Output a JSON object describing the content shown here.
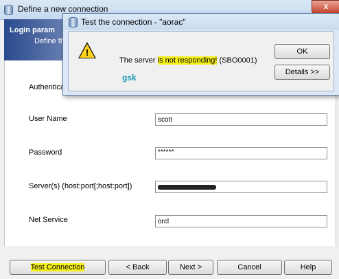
{
  "main_window": {
    "title": "Define a new connection",
    "close_glyph": "x",
    "header": {
      "title": "Login param",
      "subtitle": "Define th"
    },
    "fields": [
      {
        "label": "Authentica",
        "value": ""
      },
      {
        "label": "User Name",
        "value": "scott"
      },
      {
        "label": "Password",
        "value": "******"
      },
      {
        "label": "Server(s) (host:port[;host:port])",
        "value": ""
      },
      {
        "label": "Net Service",
        "value": "orcl"
      }
    ],
    "buttons": {
      "test_connection": "Test Connection",
      "back": "< Back",
      "next": "Next >",
      "cancel": "Cancel",
      "help": "Help"
    }
  },
  "dialog": {
    "title": "Test the connection - \"aorac\"",
    "message_before": "The server ",
    "message_highlight": "is not responding!",
    "message_after": " (SBO0001)",
    "annotation": "gsk",
    "ok_label": "OK",
    "details_label": "Details >>"
  },
  "colors": {
    "highlight": "#f5f01a",
    "header_blue": "#2a4a8e",
    "annotation_teal": "#1e9bb8"
  },
  "icons": {
    "window_icon": "database-icon",
    "dialog_icon": "warning-icon"
  }
}
